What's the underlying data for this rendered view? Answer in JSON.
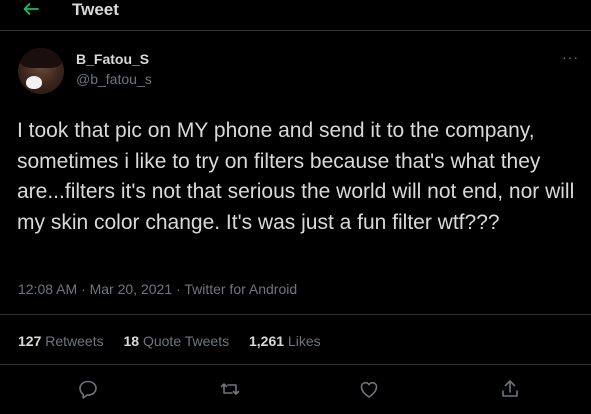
{
  "header": {
    "title": "Tweet",
    "back_icon": "back-arrow-icon",
    "accent_color": "#17bf63"
  },
  "tweet": {
    "display_name": "B_Fatou_S",
    "handle": "@b_fatou_s",
    "more_label": "···",
    "text": "I took that pic on MY phone and send it to the company, sometimes i like to try on filters because that's what they are...filters it's not that serious the world will not end, nor will my skin color change. It's was just a fun filter wtf???",
    "time": "12:08 AM",
    "date": "Mar 20, 2021",
    "source": "Twitter for Android",
    "separator": " · "
  },
  "stats": {
    "retweets_count": "127",
    "retweets_label": " Retweets",
    "quotes_count": "18",
    "quotes_label": " Quote Tweets",
    "likes_count": "1,261",
    "likes_label": " Likes"
  },
  "actions": [
    "reply-icon",
    "retweet-icon",
    "like-icon",
    "share-icon"
  ]
}
